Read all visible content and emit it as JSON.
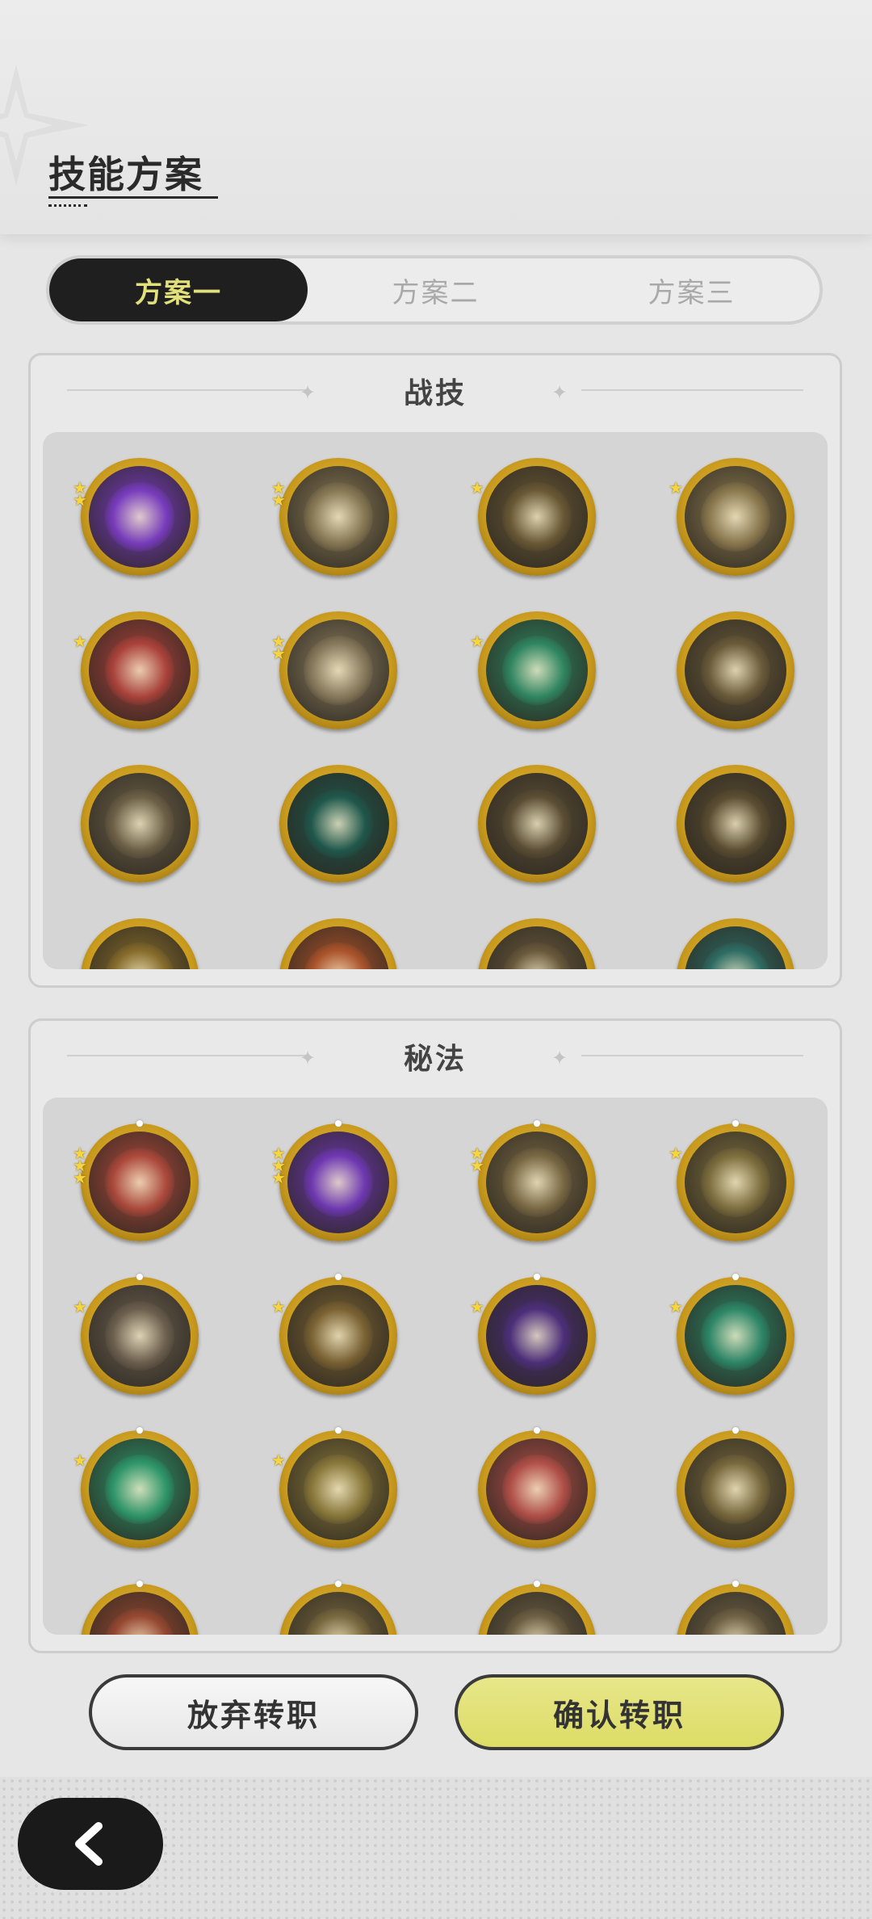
{
  "header": {
    "title": "技能方案"
  },
  "tabs": [
    {
      "label": "方案一",
      "active": true
    },
    {
      "label": "方案二",
      "active": false
    },
    {
      "label": "方案三",
      "active": false
    }
  ],
  "sections": [
    {
      "title": "战技",
      "skills": [
        {
          "icon": "purple-heart-burst-icon",
          "stars": 2,
          "color": "#7b3cc4"
        },
        {
          "icon": "gold-hand-swipe-icon",
          "stars": 2,
          "color": "#8a7a55"
        },
        {
          "icon": "gold-explosion-icon",
          "stars": 1,
          "color": "#6b5a35"
        },
        {
          "icon": "gold-swirl-icon",
          "stars": 1,
          "color": "#8d7a4f"
        },
        {
          "icon": "red-warrior-sword-icon",
          "stars": 1,
          "color": "#b0433c"
        },
        {
          "icon": "gold-charge-icon",
          "stars": 2,
          "color": "#8b7c5d"
        },
        {
          "icon": "green-upward-arrows-icon",
          "stars": 1,
          "color": "#2f8a64"
        },
        {
          "icon": "gold-shard-strike-icon",
          "stars": 0,
          "color": "#6c5c3a"
        },
        {
          "icon": "gold-spin-icon",
          "stars": 0,
          "color": "#6f6248"
        },
        {
          "icon": "teal-crescent-icon",
          "stars": 0,
          "color": "#1f5a4e"
        },
        {
          "icon": "gold-spikes-icon",
          "stars": 0,
          "color": "#5e5036"
        },
        {
          "icon": "gold-slash-icon",
          "stars": 0,
          "color": "#5d4f32"
        },
        {
          "icon": "gold-crown-icon",
          "stars": 0,
          "color": "#8a6e2b"
        },
        {
          "icon": "orange-flame-icon",
          "stars": 0,
          "color": "#b0552b"
        },
        {
          "icon": "gold-shards-icon",
          "stars": 0,
          "color": "#6b5b3c"
        },
        {
          "icon": "teal-wave-icon",
          "stars": 0,
          "color": "#2e6f66"
        }
      ]
    },
    {
      "title": "秘法",
      "skills": [
        {
          "icon": "red-shield-icon",
          "stars": 3,
          "color": "#b14a3c"
        },
        {
          "icon": "purple-flame-icon",
          "stars": 3,
          "color": "#7138b8"
        },
        {
          "icon": "gold-leaf-icon",
          "stars": 2,
          "color": "#7b6a44"
        },
        {
          "icon": "gold-eye-icon",
          "stars": 1,
          "color": "#80703e"
        },
        {
          "icon": "gold-crystal-icon",
          "stars": 1,
          "color": "#6e6150"
        },
        {
          "icon": "gold-vortex-icon",
          "stars": 1,
          "color": "#7d6433"
        },
        {
          "icon": "purple-panther-icon",
          "stars": 1,
          "color": "#4e2f7e"
        },
        {
          "icon": "teal-heal-icon",
          "stars": 1,
          "color": "#2c8a6a"
        },
        {
          "icon": "green-sword-icon",
          "stars": 1,
          "color": "#2d9a6c"
        },
        {
          "icon": "gold-guardian-icon",
          "stars": 1,
          "color": "#8c7a3a"
        },
        {
          "icon": "red-sword-icon",
          "stars": 0,
          "color": "#b65049"
        },
        {
          "icon": "gold-golem-icon",
          "stars": 0,
          "color": "#7a6a3d"
        },
        {
          "icon": "red-skill-icon",
          "stars": 0,
          "color": "#9b4a32"
        },
        {
          "icon": "gold-skill-icon",
          "stars": 0,
          "color": "#7c6b40"
        },
        {
          "icon": "gold-skill-icon",
          "stars": 0,
          "color": "#6f6144"
        },
        {
          "icon": "gold-skill-icon",
          "stars": 0,
          "color": "#726446"
        }
      ]
    }
  ],
  "buttons": {
    "cancel": "放弃转职",
    "confirm": "确认转职"
  },
  "colors": {
    "accent": "#e2e07a",
    "dark": "#1f1f1f",
    "gold": "#c99a1c"
  }
}
